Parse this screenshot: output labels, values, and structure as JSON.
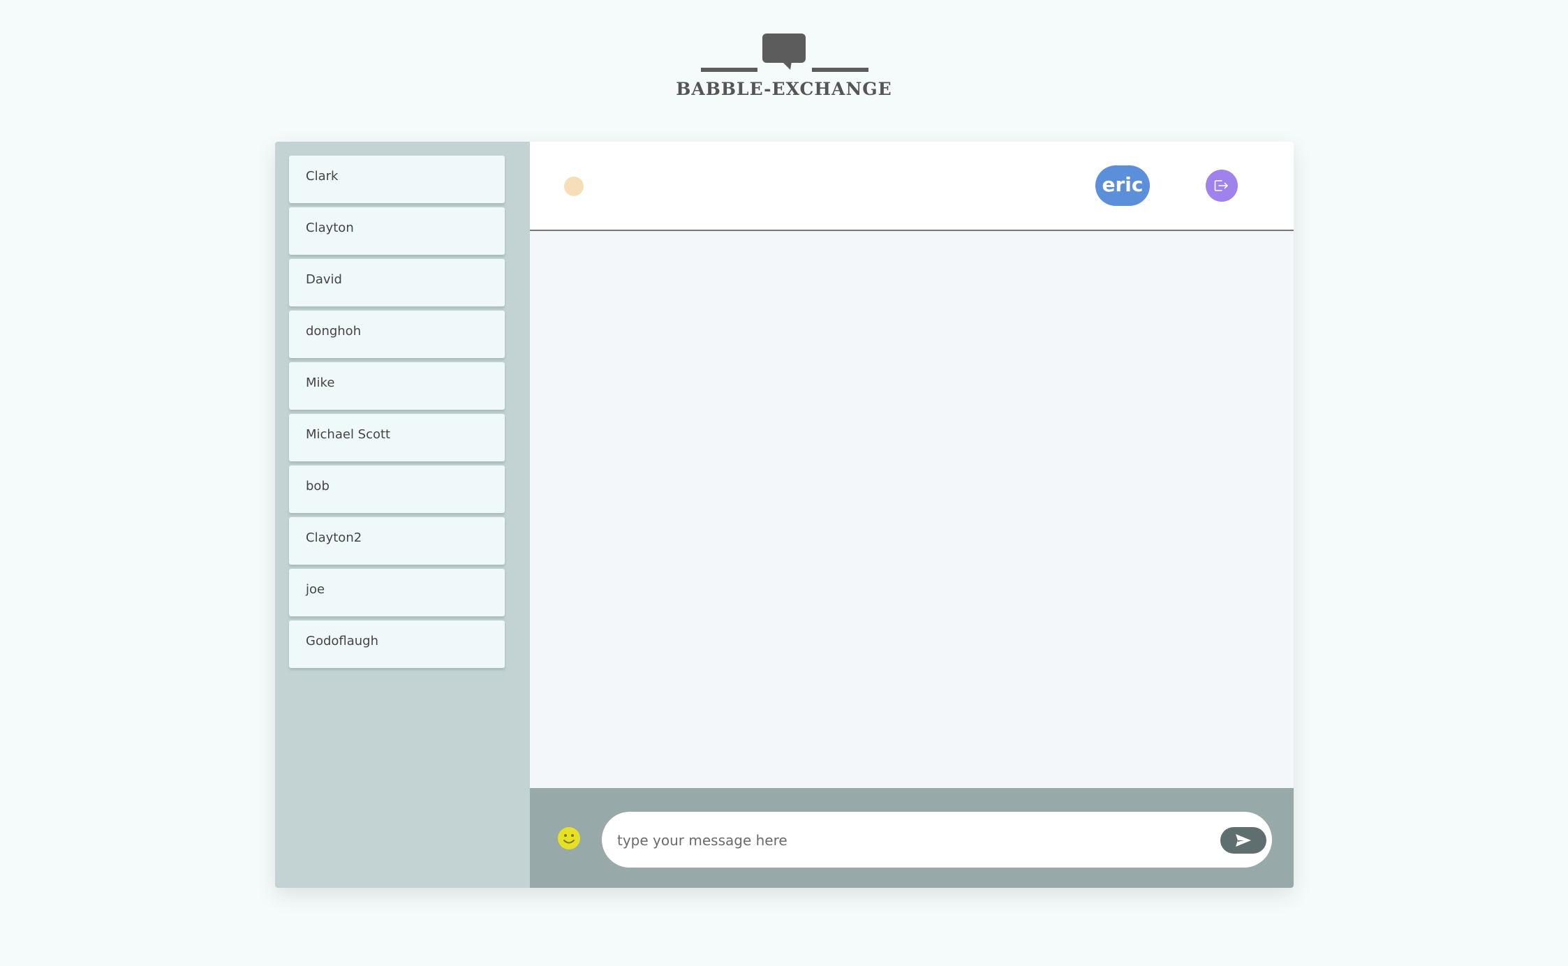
{
  "app": {
    "title": "BABBLE-EXCHANGE"
  },
  "sidebar": {
    "contacts": [
      {
        "name": "Clark"
      },
      {
        "name": "Clayton"
      },
      {
        "name": "David"
      },
      {
        "name": "donghoh"
      },
      {
        "name": "Mike"
      },
      {
        "name": "Michael Scott"
      },
      {
        "name": "bob"
      },
      {
        "name": "Clayton2"
      },
      {
        "name": "joe"
      },
      {
        "name": "Godoflaugh"
      }
    ]
  },
  "topbar": {
    "username": "eric",
    "status_color": "#f6dfb8",
    "user_color": "#5b8fd9",
    "logout_icon": "logout-icon",
    "logout_color": "#9f82ec"
  },
  "composer": {
    "placeholder": "type your message here",
    "value": "",
    "emoji_icon": "smiley-icon",
    "send_icon": "send-icon"
  }
}
